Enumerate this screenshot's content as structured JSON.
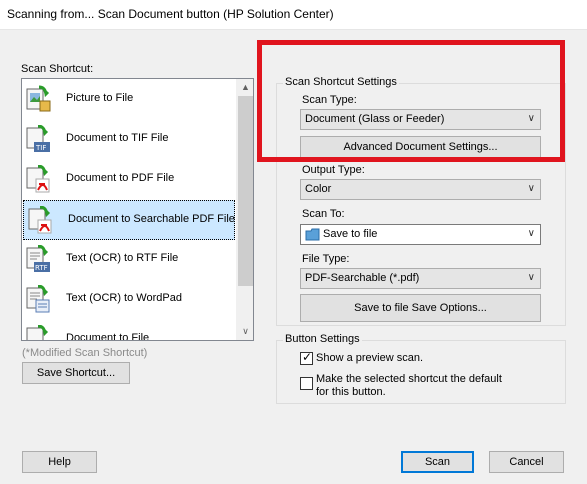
{
  "window": {
    "title": "Scanning from... Scan Document button (HP Solution Center)"
  },
  "shortcuts": {
    "label": "Scan Shortcut:",
    "items": [
      {
        "label": "Picture to File",
        "icon": "picture-to-file-icon"
      },
      {
        "label": "Document to TIF File",
        "icon": "tif-file-icon"
      },
      {
        "label": "Document to PDF File",
        "icon": "pdf-file-icon"
      },
      {
        "label": "Document to Searchable PDF File",
        "icon": "searchable-pdf-icon",
        "selected": true
      },
      {
        "label": "Text (OCR) to RTF File",
        "icon": "rtf-file-icon"
      },
      {
        "label": "Text (OCR) to WordPad",
        "icon": "wordpad-icon"
      },
      {
        "label": "Document to File",
        "icon": "document-to-file-icon"
      }
    ],
    "modified_note": "(*Modified Scan Shortcut)",
    "save_button": "Save Shortcut..."
  },
  "settings": {
    "group_label": "Scan Shortcut Settings",
    "scan_type_label": "Scan Type:",
    "scan_type_value": "Document (Glass or Feeder)",
    "advanced_button": "Advanced Document Settings...",
    "output_type_label": "Output Type:",
    "output_type_value": "Color",
    "scan_to_label": "Scan To:",
    "scan_to_value": "Save to file",
    "file_type_label": "File Type:",
    "file_type_value": "PDF-Searchable (*.pdf)",
    "save_options_button": "Save to file Save Options..."
  },
  "button_settings": {
    "group_label": "Button Settings",
    "preview_label": "Show a preview scan.",
    "preview_checked": true,
    "default_label_line1": "Make the selected shortcut the default",
    "default_label_line2": "for this button.",
    "default_checked": false
  },
  "footer": {
    "help": "Help",
    "scan": "Scan",
    "cancel": "Cancel"
  },
  "colors": {
    "highlight_box": "#e0141e",
    "selection": "#cce8ff",
    "default_button_border": "#0078d7"
  }
}
